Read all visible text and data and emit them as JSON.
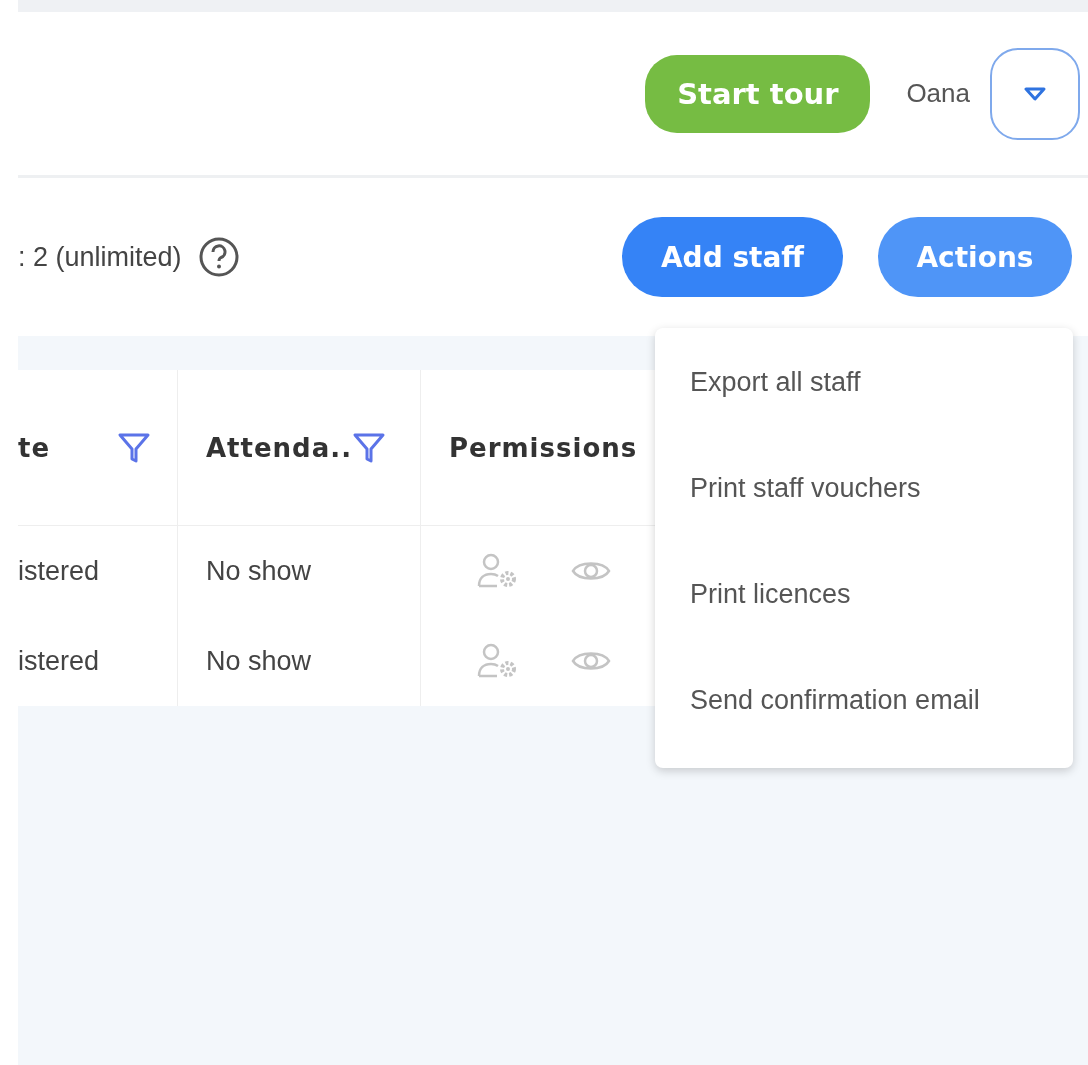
{
  "header": {
    "tour_button": "Start tour",
    "user_name": "Oana"
  },
  "toolbar": {
    "count_text": ": 2 (unlimited)",
    "add_button": "Add staff",
    "actions_button": {
      "label": "Actions",
      "expanded": true
    }
  },
  "table": {
    "columns": [
      {
        "label": "te",
        "filter": true
      },
      {
        "label": "Attenda..",
        "filter": true
      },
      {
        "label": "Permissions",
        "filter": false
      }
    ],
    "rows": [
      {
        "cells": [
          "istered",
          "No show"
        ]
      },
      {
        "cells": [
          "istered",
          "No show"
        ]
      }
    ]
  },
  "actions_menu": [
    "Export all staff",
    "Print staff vouchers",
    "Print licences",
    "Send confirmation email"
  ]
}
